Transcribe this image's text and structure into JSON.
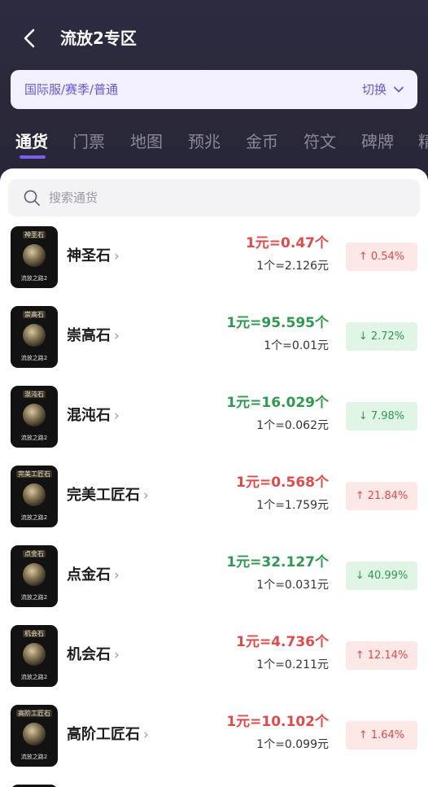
{
  "header": {
    "title": "流放2专区"
  },
  "server": {
    "label": "国际服/赛季/普通",
    "switch_label": "切换"
  },
  "tabs": [
    {
      "label": "通货"
    },
    {
      "label": "门票"
    },
    {
      "label": "地图"
    },
    {
      "label": "预兆"
    },
    {
      "label": "金币"
    },
    {
      "label": "符文"
    },
    {
      "label": "碑牌"
    },
    {
      "label": "精"
    }
  ],
  "search": {
    "placeholder": "搜索通货"
  },
  "colors": {
    "up": "#e24a4a",
    "down": "#2e9a4f",
    "accent": "#7d5cf0"
  },
  "items": [
    {
      "thumb_label": "神圣石",
      "thumb_foot": "流放之路2",
      "name": "神圣石",
      "arrow": "›",
      "rate_main": "1元=0.47个",
      "rate_sub": "1个=2.126元",
      "change": "↑ 0.54%",
      "direction": "up"
    },
    {
      "thumb_label": "崇高石",
      "thumb_foot": "流放之路2",
      "name": "崇高石",
      "arrow": "›",
      "rate_main": "1元=95.595个",
      "rate_sub": "1个=0.01元",
      "change": "↓ 2.72%",
      "direction": "down"
    },
    {
      "thumb_label": "混沌石",
      "thumb_foot": "流放之路2",
      "name": "混沌石",
      "arrow": "›",
      "rate_main": "1元=16.029个",
      "rate_sub": "1个=0.062元",
      "change": "↓ 7.98%",
      "direction": "down"
    },
    {
      "thumb_label": "完美工匠石",
      "thumb_foot": "流放之路2",
      "name": "完美工匠石",
      "arrow": "›",
      "rate_main": "1元=0.568个",
      "rate_sub": "1个=1.759元",
      "change": "↑ 21.84%",
      "direction": "up"
    },
    {
      "thumb_label": "点金石",
      "thumb_foot": "流放之路2",
      "name": "点金石",
      "arrow": "›",
      "rate_main": "1元=32.127个",
      "rate_sub": "1个=0.031元",
      "change": "↓ 40.99%",
      "direction": "down"
    },
    {
      "thumb_label": "机会石",
      "thumb_foot": "流放之路2",
      "name": "机会石",
      "arrow": "›",
      "rate_main": "1元=4.736个",
      "rate_sub": "1个=0.211元",
      "change": "↑ 12.14%",
      "direction": "up"
    },
    {
      "thumb_label": "高阶工匠石",
      "thumb_foot": "流放之路2",
      "name": "高阶工匠石",
      "arrow": "›",
      "rate_main": "1元=10.102个",
      "rate_sub": "1个=0.099元",
      "change": "↑ 1.64%",
      "direction": "up"
    }
  ]
}
